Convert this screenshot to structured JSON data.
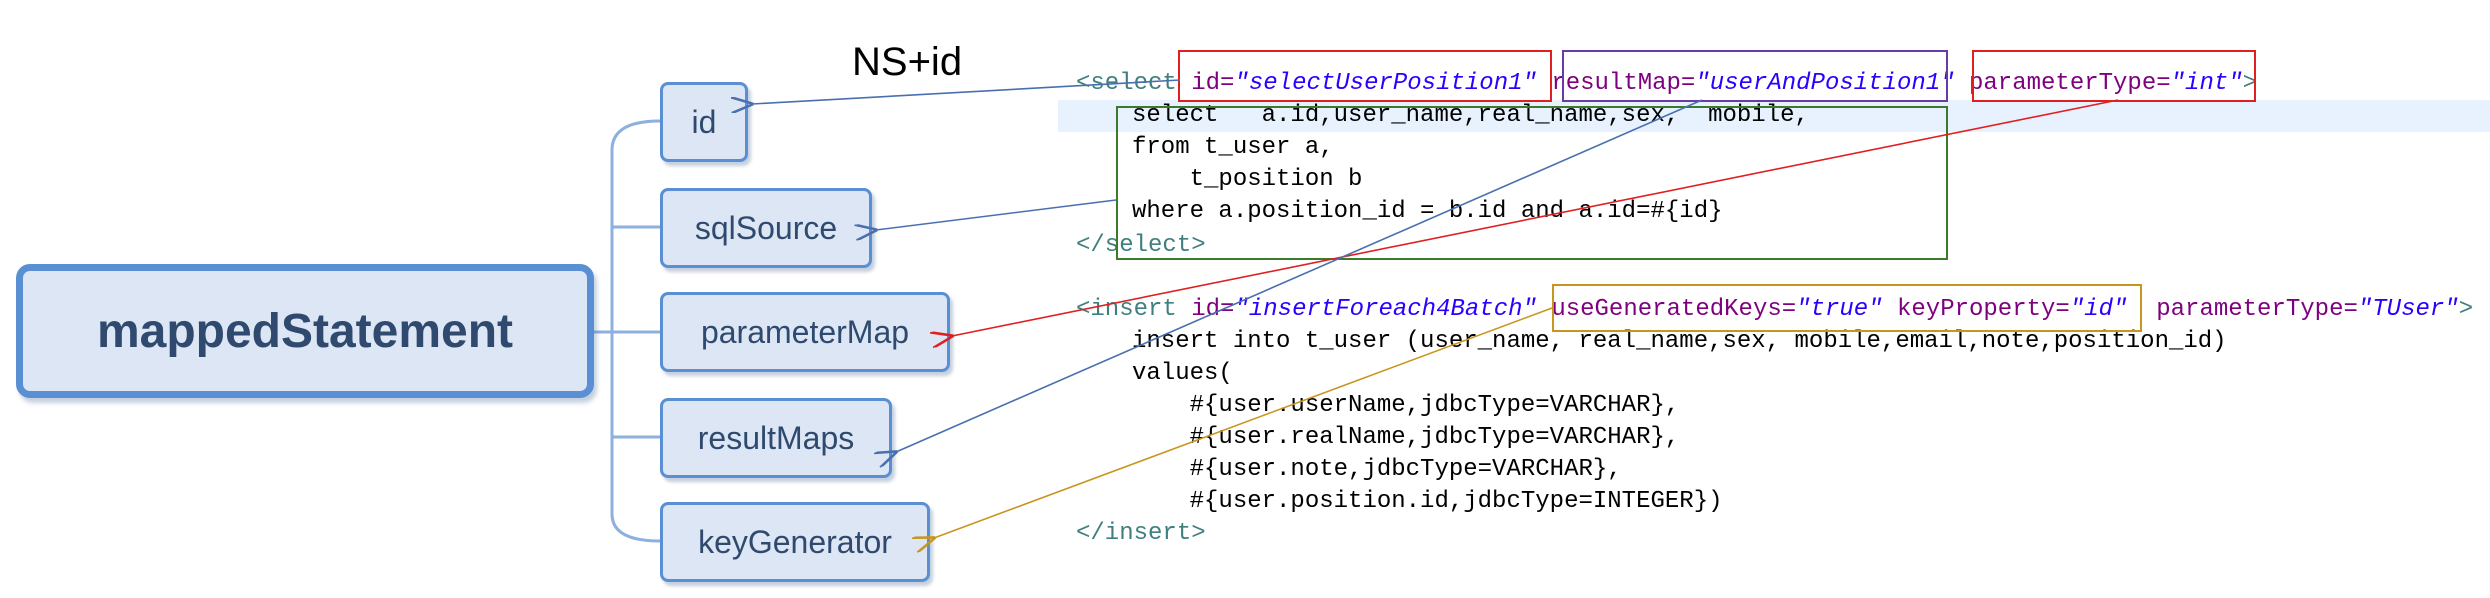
{
  "root_label": "mappedStatement",
  "children": [
    "id",
    "sqlSource",
    "parameterMap",
    "resultMaps",
    "keyGenerator"
  ],
  "annotation": "NS+id",
  "select_block": {
    "open_tag": "<select",
    "id_attr": "id=",
    "id_val": "\"selectUserPosition1\"",
    "resultmap_attr": "resultMap=",
    "resultmap_val": "\"userAndPosition1\"",
    "paramtype_attr": "parameterType=",
    "paramtype_val": "\"int\"",
    "open_end": ">",
    "body": [
      "select   a.id,user_name,real_name,sex,  mobile,",
      "from t_user a,",
      "    t_position b",
      "where a.position_id = b.id and a.id=#{id}"
    ],
    "close_tag": "</select>"
  },
  "insert_block": {
    "open_tag": "<insert",
    "id_attr": "id=",
    "id_val": "\"insertForeach4Batch\"",
    "ugk_attr": "useGeneratedKeys=",
    "ugk_val": "\"true\"",
    "kp_attr": "keyProperty=",
    "kp_val": "\"id\"",
    "pt_attr": "parameterType=",
    "pt_val": "\"TUser\"",
    "open_end": ">",
    "body": [
      "insert into t_user (user_name, real_name,sex, mobile,email,note,position_id)",
      "values(",
      "    #{user.userName,jdbcType=VARCHAR},",
      "    #{user.realName,jdbcType=VARCHAR},",
      "    #{user.note,jdbcType=VARCHAR},",
      "    #{user.position.id,jdbcType=INTEGER})"
    ],
    "close_tag": "</insert>"
  },
  "colors": {
    "node_fill": "#dce6f4",
    "node_border": "#5b8fd3",
    "connector": "#8db0de",
    "red": "#e02020",
    "purple": "#6a3aa8",
    "green": "#3a7a2a",
    "gold": "#c8961e",
    "blue_arrow": "#4a6fb0"
  }
}
